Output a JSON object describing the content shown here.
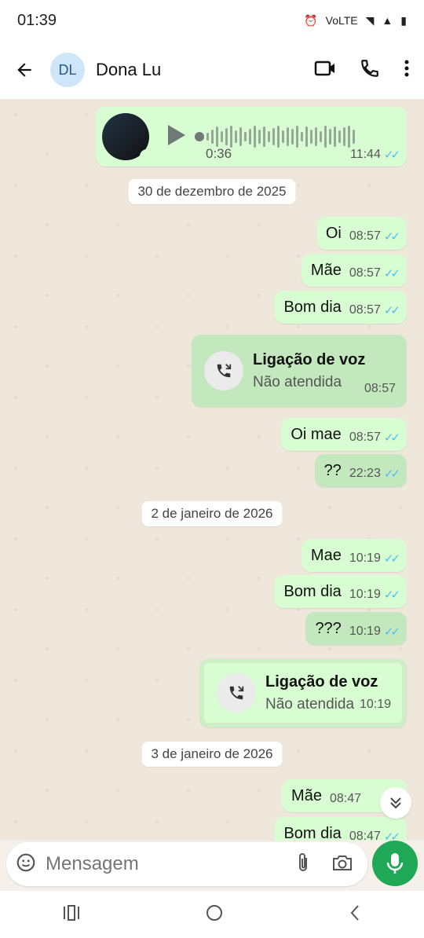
{
  "status": {
    "time": "01:39"
  },
  "header": {
    "avatar_initials": "DL",
    "contact_name": "Dona Lu"
  },
  "audio": {
    "duration": "0:36",
    "time": "11:44",
    "progress": 0.0
  },
  "dates": [
    "30 de dezembro de 2025",
    "2 de janeiro de 2026",
    "3 de janeiro de 2026"
  ],
  "messages": [
    {
      "text": "Oi",
      "time": "08:57"
    },
    {
      "text": "Mãe",
      "time": "08:57"
    },
    {
      "text": "Bom dia",
      "time": "08:57"
    },
    {
      "text": "Oi mae",
      "time": "08:57"
    },
    {
      "text": "??",
      "time": "22:23"
    },
    {
      "text": "Mae",
      "time": "10:19"
    },
    {
      "text": "Bom dia",
      "time": "10:19"
    },
    {
      "text": "???",
      "time": "10:19"
    },
    {
      "text": "Mãe",
      "time": "08:47"
    },
    {
      "text": "Bom dia",
      "time": "08:47"
    }
  ],
  "calls": [
    {
      "title": "Ligação de voz",
      "status": "Não atendida",
      "time": "08:57"
    },
    {
      "title": "Ligação de voz",
      "status": "Não atendida",
      "time": "10:19"
    }
  ],
  "composer": {
    "placeholder": "Mensagem"
  },
  "colors": {
    "accent": "#1fa855",
    "outgoing_bubble": "#d9fdd3",
    "read_ticks": "#53bdeb"
  }
}
